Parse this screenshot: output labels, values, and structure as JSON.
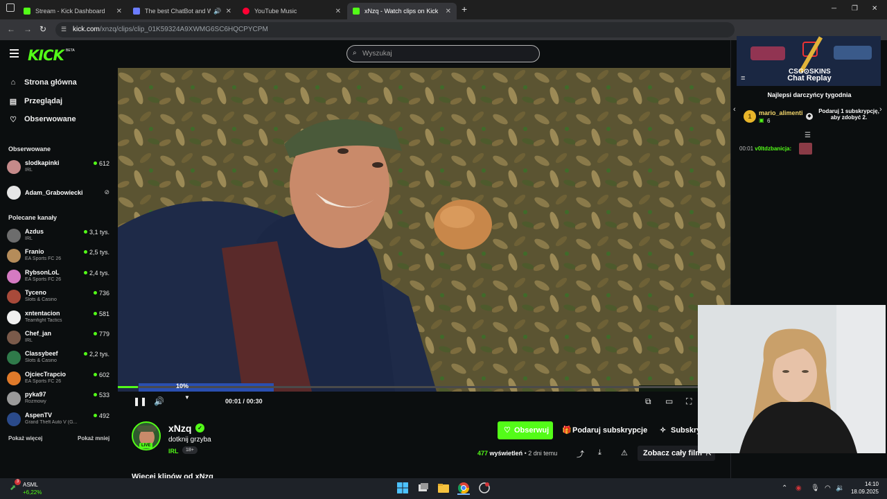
{
  "browser": {
    "tabs": [
      {
        "label": "Stream - Kick Dashboard",
        "color": "#53fc18"
      },
      {
        "label": "The best ChatBot and Widg",
        "color": "#6b7cff"
      },
      {
        "label": "YouTube Music",
        "color": "#ff0033"
      },
      {
        "label": "xNzq - Watch clips on Kick",
        "color": "#53fc18"
      }
    ],
    "url_host": "kick.com",
    "url_path": "/xnzq/clips/clip_01K59324A9XWMG6SC6HQCPYCPM"
  },
  "header": {
    "logo": "KICK",
    "logo_badge": "BETA",
    "search_placeholder": "Wyszukaj"
  },
  "sidebar": {
    "nav": [
      {
        "label": "Strona główna",
        "icon": "home-icon"
      },
      {
        "label": "Przeglądaj",
        "icon": "browse-icon"
      },
      {
        "label": "Obserwowane",
        "icon": "heart-icon"
      }
    ],
    "followed_heading": "Obserwowane",
    "followed": [
      {
        "name": "slodkapinki",
        "category": "IRL",
        "viewers": "612",
        "avatar_color": "#c58a8a"
      },
      {
        "name": "Adam_Grabowiecki",
        "category": "",
        "viewers": "",
        "avatar_color": "#e6e6e6"
      }
    ],
    "recommended_heading": "Polecane kanały",
    "recommended": [
      {
        "name": "Azdus",
        "category": "IRL",
        "viewers": "3,1 tys.",
        "avatar_color": "#6d6d6d"
      },
      {
        "name": "Franio",
        "category": "EA Sports FC 26",
        "viewers": "2,5 tys.",
        "avatar_color": "#b58c5a"
      },
      {
        "name": "RybsonLoL",
        "category": "EA Sports FC 26",
        "viewers": "2,4 tys.",
        "avatar_color": "#d57ac2"
      },
      {
        "name": "Tyceno",
        "category": "Slots & Casino",
        "viewers": "736",
        "avatar_color": "#a84a3a"
      },
      {
        "name": "xntentacion",
        "category": "Teamfight Tactics",
        "viewers": "581",
        "avatar_color": "#f0f0f0"
      },
      {
        "name": "Chef_jan",
        "category": "IRL",
        "viewers": "779",
        "avatar_color": "#7a5a4a"
      },
      {
        "name": "Classybeef",
        "category": "Slots & Casino",
        "viewers": "2,2 tys.",
        "avatar_color": "#2f7a4a"
      },
      {
        "name": "OjciecTrapcio",
        "category": "EA Sports FC 26",
        "viewers": "602",
        "avatar_color": "#e07a2a"
      },
      {
        "name": "pyka97",
        "category": "Rozmowy",
        "viewers": "533",
        "avatar_color": "#9a9a9a"
      },
      {
        "name": "AspenTV",
        "category": "Grand Theft Auto V (G...",
        "viewers": "492",
        "avatar_color": "#2a4a8a"
      }
    ],
    "show_more": "Pokaż więcej",
    "show_less": "Pokaż mniej"
  },
  "player": {
    "progress_fraction": 0.033,
    "seek_tooltip": "10%",
    "time_current": "00:01",
    "time_separator": "/",
    "time_total": "00:30"
  },
  "clip": {
    "channel_name": "xNzq",
    "live_label": "LIVE",
    "title": "dotknij grzyba",
    "category": "IRL",
    "age_badge": "18+",
    "follow_label": "Obserwuj",
    "gift_label": "Podaruj subskrypcje",
    "subscribe_label": "Subskrybuj",
    "views_count": "477",
    "views_word": "wyświetleń",
    "views_sep": "•",
    "posted": "2 dni temu",
    "full_video_label": "Zobacz cały film",
    "more_clips_heading": "Więcej klipów od xNzq"
  },
  "chat": {
    "ad_text": "CSG⊙SKINS",
    "title": "Chat Replay",
    "donors_heading": "Najlepsi darczyńcy tygodnia",
    "top_donor_rank": "1",
    "top_donor_name": "mario_alimenti",
    "top_donor_count": "6",
    "donor_cta": "Podaruj 1 subskrypcję, aby zdobyć 2.",
    "message_time": "00:01",
    "message_user": "v0ltdzbanicja:"
  },
  "taskbar": {
    "stock_name": "ASML",
    "stock_change": "+6,22%",
    "stock_badge": "3",
    "clock_time": "14:10",
    "clock_date": "18.09.2025"
  },
  "colors": {
    "accent": "#53fc18",
    "background": "#0b0e0f"
  }
}
